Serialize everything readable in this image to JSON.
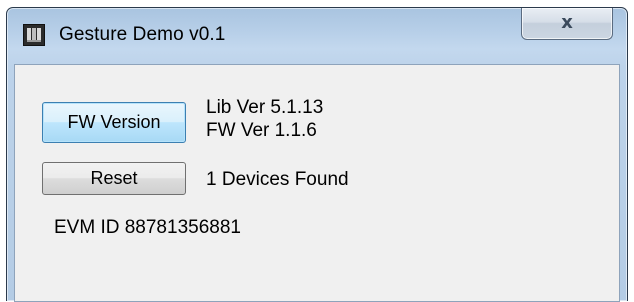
{
  "window": {
    "title": "Gesture Demo v0.1",
    "close_glyph": "x"
  },
  "buttons": {
    "fw_version_label": "FW Version",
    "reset_label": "Reset"
  },
  "info": {
    "lib_version": "Lib Ver 5.1.13",
    "fw_version": "FW Ver 1.1.6",
    "devices_found": "1 Devices Found",
    "evm_id": "EVM ID 88781356881"
  },
  "icons": {
    "app_icon": "app-logo-icon",
    "close_icon": "close-icon"
  },
  "colors": {
    "title_bar": "#b7cfe8",
    "client_bg": "#f0f0f0",
    "focused_button": "#bee6fd"
  }
}
